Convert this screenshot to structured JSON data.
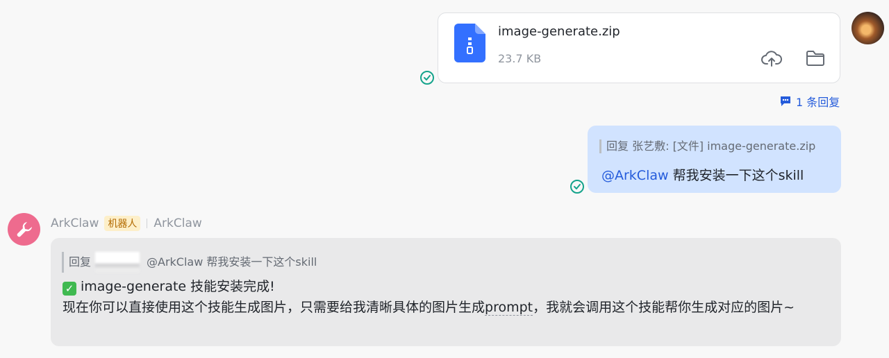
{
  "file_message": {
    "file_name": "image-generate.zip",
    "file_size": "23.7 KB",
    "file_icon": "zip-file-icon",
    "actions": [
      "upload-cloud-icon",
      "folder-icon"
    ]
  },
  "thread": {
    "label": "1 条回复"
  },
  "reply_message": {
    "quote": "回复 张艺敷: [文件] image-generate.zip",
    "mention": "@ArkClaw",
    "text": "帮我安装一下这个skill"
  },
  "bot_message": {
    "sender": "ArkClaw",
    "tag": "机器人",
    "source": "ArkClaw",
    "quote_prefix": "回复",
    "quote_text": "@ArkClaw 帮我安装一下这个skill",
    "line1": "image-generate 技能安装完成!",
    "line2_pre": "现在你可以直接使用这个技能生成图片，只需要给我清晰具体的图片生成",
    "line2_link": "prompt",
    "line2_post": "，我就会调用这个技能帮你生成对应的图片~"
  },
  "colors": {
    "accent": "#245bdb",
    "read_check": "#14a38b",
    "bot_avatar": "#ee6b8e",
    "reply_bubble": "#d1e3ff"
  }
}
